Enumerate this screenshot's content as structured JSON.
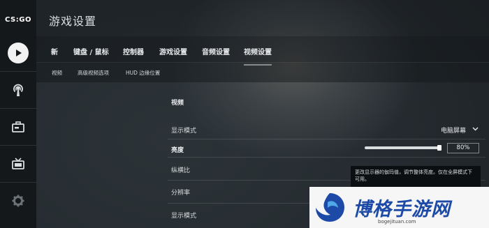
{
  "app": {
    "logo_text": "CS:GO",
    "title": "游戏设置"
  },
  "sidebar": {
    "icons": [
      "play-icon",
      "broadcast-icon",
      "inventory-icon",
      "tv-icon",
      "gear-icon"
    ]
  },
  "tabs": [
    "新",
    "键盘 / 鼠标",
    "控制器",
    "游戏设置",
    "音频设置",
    "视频设置"
  ],
  "active_tab": "视频设置",
  "subtabs": [
    "视频",
    "高级视频选项",
    "HUD 边缘位置"
  ],
  "section": {
    "title": "视频"
  },
  "settings": {
    "display_mode": {
      "label": "显示模式",
      "value": "电脑屏幕"
    },
    "brightness": {
      "label": "亮度",
      "value": "80%",
      "level": 0.8
    },
    "aspect_ratio": {
      "label": "纵横比"
    },
    "resolution": {
      "label": "分辨率"
    },
    "display_mode_2": {
      "label": "显示模式"
    }
  },
  "tooltip": {
    "text": "更改显示器的伽玛值，调节整体亮度。仅在全屏模式下可用。"
  },
  "watermark": {
    "brand": "博格手游网",
    "url": "bogejituan.com"
  },
  "colors": {
    "accent": "#e8eaec",
    "sidebar_bg": "#14181b",
    "watermark_blue": "#1d4aa7"
  }
}
